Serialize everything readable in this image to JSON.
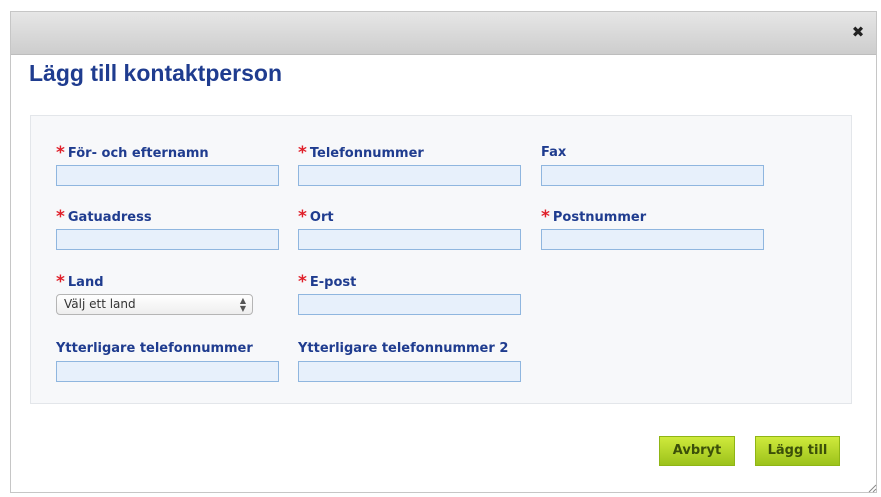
{
  "dialog": {
    "close_icon": "close-icon",
    "close_glyph": "✖",
    "title": "Lägg till kontaktperson"
  },
  "form": {
    "required_marker": "*",
    "full_name": {
      "label": "För- och efternamn",
      "required": true,
      "value": ""
    },
    "phone": {
      "label": "Telefonnummer",
      "required": true,
      "value": ""
    },
    "fax": {
      "label": "Fax",
      "required": false,
      "value": ""
    },
    "street": {
      "label": "Gatuadress",
      "required": true,
      "value": ""
    },
    "city": {
      "label": "Ort",
      "required": true,
      "value": ""
    },
    "postal_code": {
      "label": "Postnummer",
      "required": true,
      "value": ""
    },
    "country": {
      "label": "Land",
      "required": true,
      "selected": "Välj ett land"
    },
    "email": {
      "label": "E-post",
      "required": true,
      "value": ""
    },
    "extra_phone": {
      "label": "Ytterligare telefonnummer",
      "required": false,
      "value": ""
    },
    "extra_phone_2": {
      "label": "Ytterligare telefonnummer 2",
      "required": false,
      "value": ""
    }
  },
  "buttons": {
    "cancel": "Avbryt",
    "add": "Lägg till"
  },
  "colors": {
    "title": "#1f3c8f",
    "label": "#1f3c8f",
    "required": "#e0202a",
    "input_bg": "#e7f0fb",
    "input_border": "#8fb6df",
    "button": "#b5d62b"
  }
}
